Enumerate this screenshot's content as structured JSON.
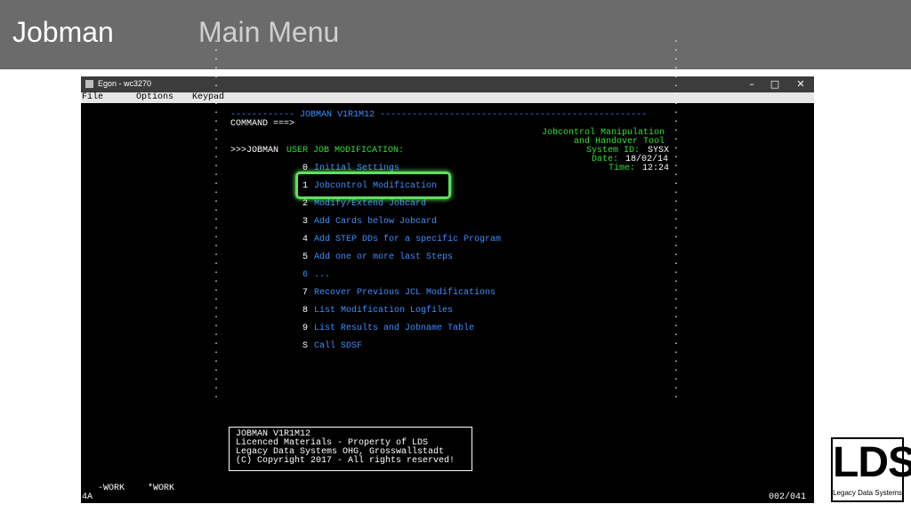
{
  "banner": {
    "app": "Jobman",
    "section": "Main Menu"
  },
  "window": {
    "title": "Egon - wc3270",
    "controls": {
      "minimize": "–",
      "maximize": "□",
      "close": "✕"
    },
    "menu": [
      "File",
      "Options",
      "Keypad"
    ]
  },
  "terminal": {
    "header_line": "------------ JOBMAN V1R1M12 --------------------------------------------------",
    "command_prompt": "COMMAND ===>",
    "tool_name_1": "Jobcontrol Manipulation",
    "tool_name_2": "and Handover Tool",
    "system_id_label": "System ID:",
    "system_id": "SYSX",
    "date_label": "Date:",
    "date": "18/02/14",
    "time_label": "Time:",
    "time": "12:24",
    "breadcrumb_prefix": ">>>JOBMAN",
    "breadcrumb_rest": "USER JOB MODIFICATION:",
    "menu_items": [
      {
        "key": "0",
        "label": "Initial Settings"
      },
      {
        "key": "1",
        "label": "Jobcontrol Modification"
      },
      {
        "key": "2",
        "label": "Modify/Extend Jobcard"
      },
      {
        "key": "3",
        "label": "Add Cards below Jobcard"
      },
      {
        "key": "4",
        "label": "Add STEP DDs for a specific Program"
      },
      {
        "key": "5",
        "label": "Add one or more last Steps"
      },
      {
        "key": "6",
        "label": "..."
      },
      {
        "key": "7",
        "label": "Recover Previous JCL Modifications"
      },
      {
        "key": "8",
        "label": "List Modification Logfiles"
      },
      {
        "key": "9",
        "label": "List Results and Jobname Table"
      },
      {
        "key": "S",
        "label": "Call SDSF"
      }
    ],
    "info_box": [
      "JOBMAN V1R1M12",
      "Licenced Materials - Property of LDS",
      "Legacy Data Systems OHG, Grosswallstadt",
      "(C) Copyright 2017 - All rights reserved!"
    ],
    "pf_labels": [
      "-WORK",
      "*WORK"
    ],
    "oia_left": "4A",
    "oia_right": "002/041",
    "highlighted_item": "1"
  },
  "logo": {
    "text": "LDS",
    "subtitle": "Legacy Data Systems"
  },
  "colors": {
    "banner": "#6b6b6b",
    "terminal_bg": "#000000",
    "green": "#33e033",
    "blue": "#3d8fff",
    "highlight": "#5fe05f"
  }
}
